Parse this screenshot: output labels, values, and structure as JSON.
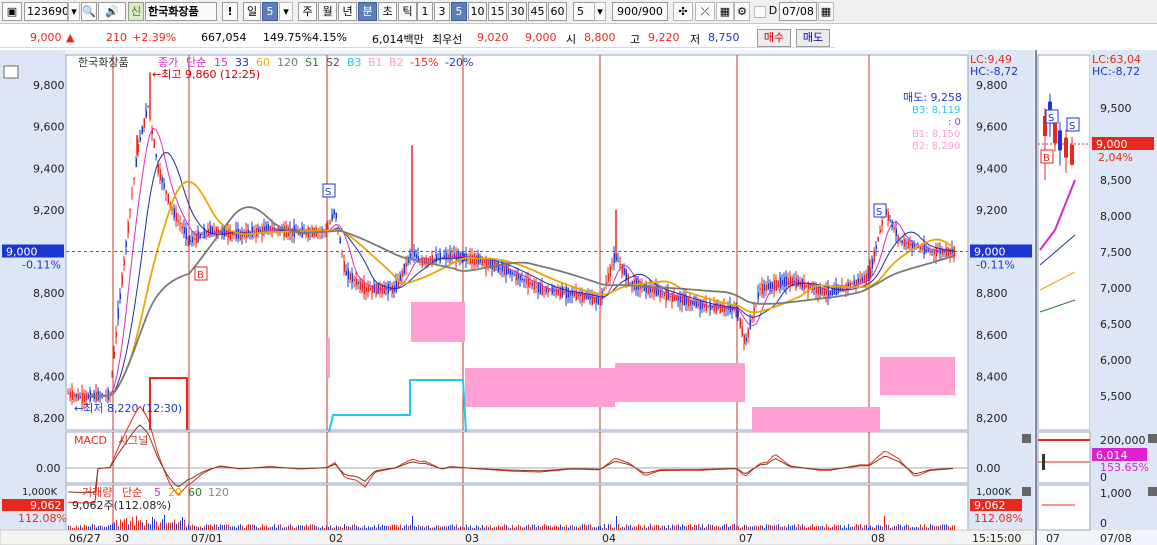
{
  "toolbar": {
    "code": "123690",
    "badge": "신",
    "stock_name": "한국화장품",
    "excl": "!",
    "period_sel": "일",
    "period_num": "5",
    "periods": [
      "주",
      "월",
      "년",
      "분",
      "초",
      "틱"
    ],
    "active_period": "분",
    "intervals": [
      "1",
      "3",
      "5",
      "10",
      "15",
      "30",
      "45",
      "60"
    ],
    "active_interval": "5",
    "interval_select": "5",
    "count": "900/900",
    "date": "07/08"
  },
  "quote": {
    "price": "9,000",
    "change": "210",
    "change_pct": "+2.39%",
    "volume": "667,054",
    "vol_ratio": "149.75%",
    "turnover": "4.15%",
    "amount": "6,014백만",
    "best_label": "최우선",
    "best_sell": "9,020",
    "best_buy": "9,000",
    "open_label": "시",
    "open": "8,800",
    "high_label": "고",
    "high": "9,220",
    "low_label": "저",
    "low": "8,750",
    "buy_btn": "매수",
    "sell_btn": "매도"
  },
  "legend": {
    "name": "한국화장품",
    "close_label": "종가",
    "ma_type": "단순",
    "ma15": "15",
    "ma33": "33",
    "ma60": "60",
    "ma120": "120",
    "s1": "S1",
    "s2": "S2",
    "b3": "B3",
    "b1": "B1",
    "b2": "B2",
    "env_low": "-15%",
    "env_low2": "-20%"
  },
  "annotations": {
    "high_note": "최고 9,860 (12:25)",
    "low_note": "최저 8,220 (12:30)",
    "order_sell": "매도: 9,258",
    "order_b3": "B3: 8,119",
    "order_zero": ": 0",
    "order_b1": "B1: 8,150",
    "order_b2": "B2: 8,290",
    "lc_main": "LC:9,49",
    "hc_main": "HC:-8,72",
    "lc_side": "LC:63,04",
    "hc_side": "HC:-8,72",
    "ref_price": "9,000",
    "ref_pct": "-0.11%",
    "side_price": "9,000",
    "side_pct": "2,04%"
  },
  "y_axis_main": [
    "9,800",
    "9,600",
    "9,400",
    "9,200",
    "8,800",
    "8,600",
    "8,400",
    "8,200"
  ],
  "y_axis_side": [
    "9,500",
    "9,000",
    "8,500",
    "8,000",
    "7,500",
    "7,000",
    "6,500",
    "6,000",
    "5,500"
  ],
  "macd": {
    "label": "MACD",
    "signal_label": "시그널",
    "zero": "0.00",
    "zero_right": "0.00",
    "side_val1": "200,000",
    "side_val2": "6,014",
    "side_val3": "153.65%",
    "side_val4": "0"
  },
  "volume": {
    "label": "거래량",
    "ma_type": "단순",
    "ma5": "5",
    "ma20": "20",
    "ma60": "60",
    "ma120": "120",
    "info": "9,062주(112.08%)",
    "axis_top": "1,000K",
    "axis_val": "9,062",
    "axis_pct": "112.08%",
    "side_top": "1,000",
    "side_zero": "0"
  },
  "x_axis": [
    "06/27",
    "30",
    "07/01",
    "02",
    "03",
    "04",
    "07",
    "08"
  ],
  "x_axis_time": "15:15:00",
  "side_x_axis": [
    "07",
    "07/08"
  ],
  "colors": {
    "price_up": "#e8281c",
    "price_down": "#1a37d4",
    "ma15": "#d02dc3",
    "ma33": "#1c2fa0",
    "ma60": "#e8a800",
    "ma120": "#7a7a7a",
    "envelope": "#ff9fd2",
    "cyan": "#25c8e8",
    "axis_bg": "#dde6f4"
  }
}
